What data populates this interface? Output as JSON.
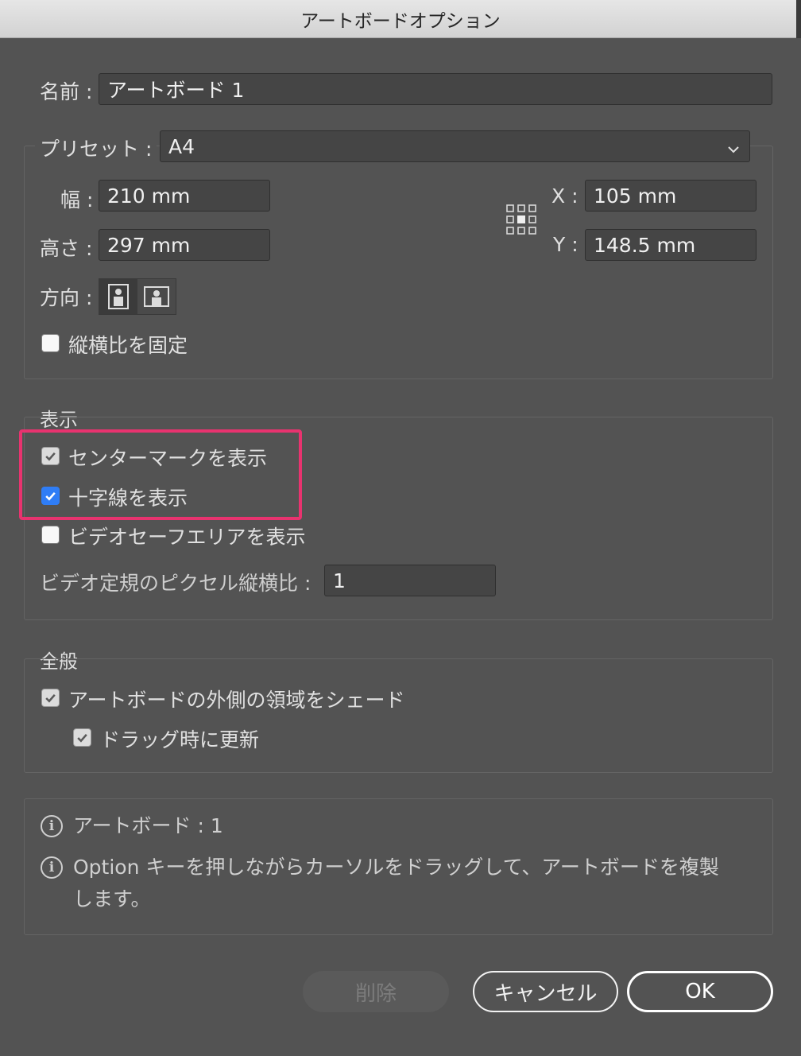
{
  "window": {
    "title": "アートボードオプション"
  },
  "name": {
    "label": "名前 :",
    "value": "アートボード 1"
  },
  "preset": {
    "label": "プリセット :",
    "value": "A4"
  },
  "width": {
    "label": "幅 :",
    "value": "210 mm"
  },
  "height": {
    "label": "高さ :",
    "value": "297 mm"
  },
  "x": {
    "label": "X :",
    "value": "105 mm"
  },
  "y": {
    "label": "Y :",
    "value": "148.5 mm"
  },
  "orientation": {
    "label": "方向 :"
  },
  "lock_ratio": {
    "label": "縦横比を固定",
    "checked": false
  },
  "display": {
    "title": "表示",
    "center_mark": {
      "label": "センターマークを表示",
      "checked": true
    },
    "cross_hairs": {
      "label": "十字線を表示",
      "checked": true
    },
    "video_safe": {
      "label": "ビデオセーフエリアを表示",
      "checked": false
    },
    "video_ratio": {
      "label": "ビデオ定規のピクセル縦横比 :",
      "value": "1"
    }
  },
  "general": {
    "title": "全般",
    "shade_outside": {
      "label": "アートボードの外側の領域をシェード",
      "checked": true
    },
    "update_drag": {
      "label": "ドラッグ時に更新",
      "checked": true
    }
  },
  "info": {
    "artboards": "アートボード : 1",
    "tip_line1": "Option キーを押しながらカーソルをドラッグして、アートボードを複製",
    "tip_line2": "します。"
  },
  "buttons": {
    "delete": "削除",
    "cancel": "キャンセル",
    "ok": "OK"
  },
  "colors": {
    "accent": "#2f7df6",
    "highlight": "#e8336f",
    "background": "#535353"
  }
}
